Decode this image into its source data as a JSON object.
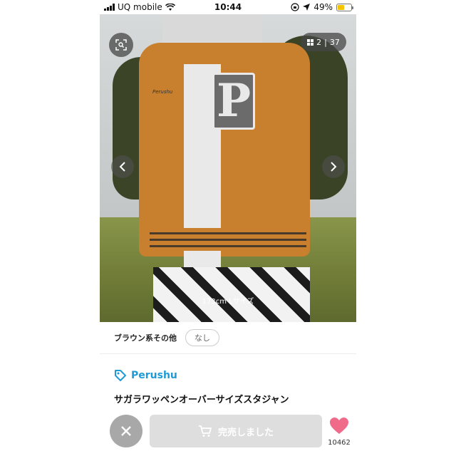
{
  "status_bar": {
    "carrier": "UQ mobile",
    "time": "10:44",
    "battery": "49%",
    "battery_level": 0.49
  },
  "photo": {
    "counter_current": "2",
    "counter_separator": "|",
    "counter_total": "37",
    "caption": "173cm Lサイズ"
  },
  "details": {
    "color_label": "ブラウン系その他",
    "color_value": "なし"
  },
  "brand": {
    "name": "Perushu"
  },
  "product": {
    "title": "サガラワッペンオーバーサイズスタジャン"
  },
  "actions": {
    "sold_label": "完売しました",
    "like_count": "10462"
  },
  "colors": {
    "accent": "#1e9bd6",
    "like": "#f06a8a",
    "disabled": "#dedede"
  },
  "icons": [
    "signal-icon",
    "wifi-icon",
    "lock-rotation-icon",
    "location-icon",
    "battery-icon",
    "zoom-icon",
    "grid-icon",
    "chevron-left-icon",
    "chevron-right-icon",
    "tag-icon",
    "close-icon",
    "cart-icon",
    "heart-icon"
  ]
}
